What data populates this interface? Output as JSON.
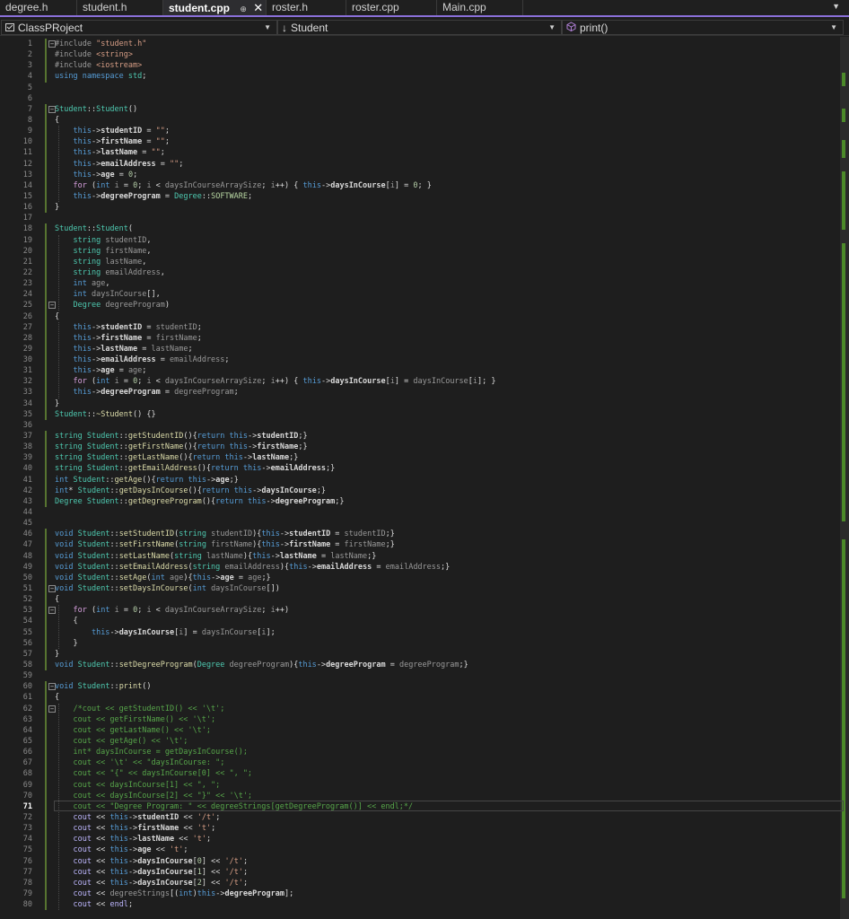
{
  "tabs": [
    {
      "label": "degree.h",
      "active": false
    },
    {
      "label": "student.h",
      "active": false
    },
    {
      "label": "student.cpp",
      "active": true,
      "pin": "⊕",
      "close": "✕"
    },
    {
      "label": "roster.h",
      "active": false
    },
    {
      "label": "roster.cpp",
      "active": false
    },
    {
      "label": "Main.cpp",
      "active": false
    }
  ],
  "tab_overflow": "▼",
  "nav": {
    "project": "ClassPRoject",
    "project_icon": "project-icon",
    "scope": "Student",
    "scope_icon": "↓",
    "member": "print()",
    "member_icon": "method-icon",
    "dropdown_caret": "▼"
  },
  "editor": {
    "current_line": 71,
    "lines": [
      "1",
      "2",
      "3",
      "4",
      "5",
      "6",
      "7",
      "8",
      "9",
      "10",
      "11",
      "12",
      "13",
      "14",
      "15",
      "16",
      "17",
      "18",
      "19",
      "20",
      "21",
      "22",
      "23",
      "24",
      "25",
      "26",
      "27",
      "28",
      "29",
      "30",
      "31",
      "32",
      "33",
      "34",
      "35",
      "36",
      "37",
      "38",
      "39",
      "40",
      "41",
      "42",
      "43",
      "44",
      "45",
      "46",
      "47",
      "48",
      "49",
      "50",
      "51",
      "52",
      "53",
      "54",
      "55",
      "56",
      "57",
      "58",
      "59",
      "60",
      "61",
      "62",
      "63",
      "64",
      "65",
      "66",
      "67",
      "68",
      "69",
      "70",
      "71",
      "72",
      "73",
      "74",
      "75",
      "76",
      "77",
      "78",
      "79",
      "80"
    ],
    "code": [
      "#include \"student.h\"",
      "#include <string>",
      "#include <iostream>",
      "using namespace std;",
      "",
      "",
      "Student::Student()",
      "{",
      "    this->studentID = \"\";",
      "    this->firstName = \"\";",
      "    this->lastName = \"\";",
      "    this->emailAddress = \"\";",
      "    this->age = 0;",
      "    for (int i = 0; i < daysInCourseArraySize; i++) { this->daysInCourse[i] = 0; }",
      "    this->degreeProgram = Degree::SOFTWARE;",
      "}",
      "",
      "Student::Student(",
      "    string studentID,",
      "    string firstName,",
      "    string lastName,",
      "    string emailAddress,",
      "    int age,",
      "    int daysInCourse[],",
      "    Degree degreeProgram)",
      "{",
      "    this->studentID = studentID;",
      "    this->firstName = firstName;",
      "    this->lastName = lastName;",
      "    this->emailAddress = emailAddress;",
      "    this->age = age;",
      "    for (int i = 0; i < daysInCourseArraySize; i++) { this->daysInCourse[i] = daysInCourse[i]; }",
      "    this->degreeProgram = degreeProgram;",
      "}",
      "Student::~Student() {}",
      "",
      "string Student::getStudentID(){return this->studentID;}",
      "string Student::getFirstName(){return this->firstName;}",
      "string Student::getLastName(){return this->lastName;}",
      "string Student::getEmailAddress(){return this->emailAddress;}",
      "int Student::getAge(){return this->age;}",
      "int* Student::getDaysInCourse(){return this->daysInCourse;}",
      "Degree Student::getDegreeProgram(){return this->degreeProgram;}",
      "",
      "",
      "void Student::setStudentID(string studentID){this->studentID = studentID;}",
      "void Student::setFirstName(string firstName){this->firstName = firstName;}",
      "void Student::setLastName(string lastName){this->lastName = lastName;}",
      "void Student::setEmailAddress(string emailAddress){this->emailAddress = emailAddress;}",
      "void Student::setAge(int age){this->age = age;}",
      "void Student::setDaysInCourse(int daysInCourse[])",
      "{",
      "    for (int i = 0; i < daysInCourseArraySize; i++)",
      "    {",
      "        this->daysInCourse[i] = daysInCourse[i];",
      "    }",
      "}",
      "void Student::setDegreeProgram(Degree degreeProgram){this->degreeProgram = degreeProgram;}",
      "",
      "void Student::print()",
      "{",
      "    /*cout << getStudentID() << '\\t';",
      "    cout << getFirstName() << '\\t';",
      "    cout << getLastName() << '\\t';",
      "    cout << getAge() << '\\t';",
      "    int* daysInCourse = getDaysInCourse();",
      "    cout << '\\t' << \"daysInCourse: \";",
      "    cout << \"{\" << daysInCourse[0] << \", \";",
      "    cout << daysInCourse[1] << \", \";",
      "    cout << daysInCourse[2] << \"}\" << '\\t';",
      "    cout << \"Degree Program: \" << degreeStrings[getDegreeProgram()] << endl;*/",
      "    cout << this->studentID << '/t';",
      "    cout << this->firstName << 't';",
      "    cout << this->lastName << 't';",
      "    cout << this->age << 't';",
      "    cout << this->daysInCourse[0] << '/t';",
      "    cout << this->daysInCourse[1] << '/t';",
      "    cout << this->daysInCourse[2] << '/t';",
      "    cout << degreeStrings[(int)this->degreeProgram];",
      "    cout << endl;"
    ]
  },
  "colors": {
    "editor_bg": "#1e1e1e",
    "accent": "#8a6fd8",
    "keyword": "#569cd6",
    "control": "#d8a0df",
    "string": "#d69d85",
    "type": "#4ec9b0",
    "function": "#dcdcaa",
    "comment": "#57a64a",
    "change_marker": "#577430"
  }
}
